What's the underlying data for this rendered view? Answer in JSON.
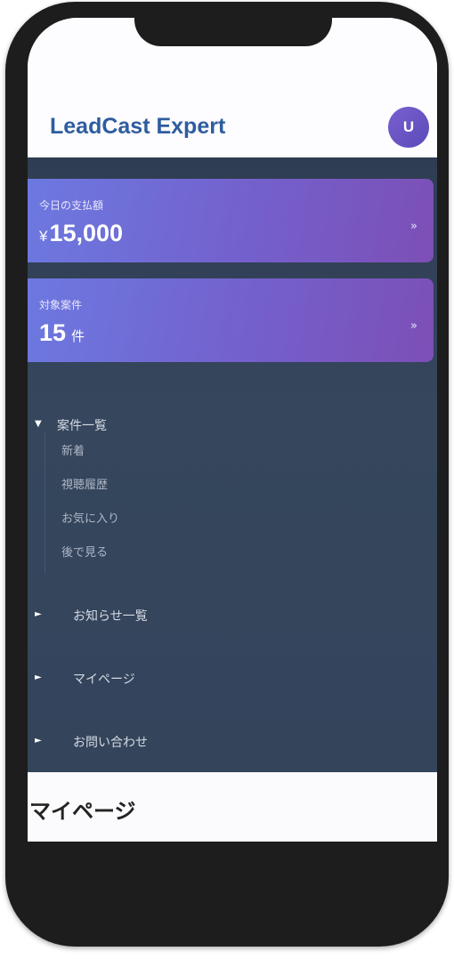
{
  "app": {
    "title": "LeadCast Expert",
    "avatar_initial": "U"
  },
  "cards": {
    "payment": {
      "label": "今日の支払額",
      "currency": "¥",
      "value": "15,000",
      "arrow": "»"
    },
    "cases": {
      "label": "対象案件",
      "value": "15",
      "unit": "件",
      "arrow": "»"
    }
  },
  "nav": {
    "case_list": {
      "arrow": "▼",
      "label": "案件一覧",
      "items": [
        {
          "label": "新着"
        },
        {
          "label": "視聴履歴"
        },
        {
          "label": "お気に入り"
        },
        {
          "label": "後で見る"
        }
      ]
    },
    "notices": {
      "arrow": "►",
      "label": "お知らせ一覧"
    },
    "mypage": {
      "arrow": "►",
      "label": "マイページ"
    },
    "contact": {
      "arrow": "►",
      "label": "お問い合わせ"
    }
  },
  "page": {
    "title": "マイページ"
  }
}
